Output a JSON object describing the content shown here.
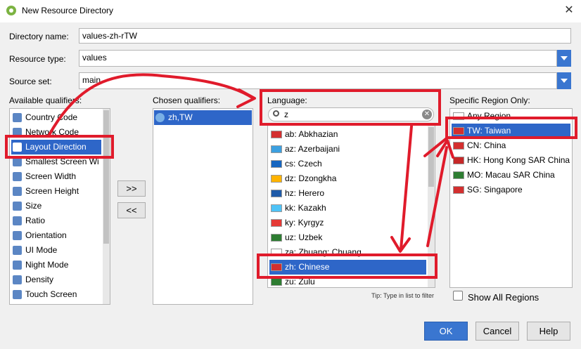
{
  "window": {
    "title": "New Resource Directory",
    "close_glyph": "✕"
  },
  "form": {
    "directory_name_label": "Directory name:",
    "directory_name_value": "values-zh-rTW",
    "resource_type_label": "Resource type:",
    "resource_type_value": "values",
    "source_set_label": "Source set:",
    "source_set_value": "main"
  },
  "available": {
    "label": "Available qualifiers:",
    "items": [
      {
        "label": "Country Code",
        "icon": "country-code-icon"
      },
      {
        "label": "Network Code",
        "icon": "network-code-icon"
      },
      {
        "label": "Layout Direction",
        "icon": "layout-direction-icon"
      },
      {
        "label": "Smallest Screen Wi",
        "icon": "smallest-screen-icon"
      },
      {
        "label": "Screen Width",
        "icon": "screen-width-icon"
      },
      {
        "label": "Screen Height",
        "icon": "screen-height-icon"
      },
      {
        "label": "Size",
        "icon": "size-icon"
      },
      {
        "label": "Ratio",
        "icon": "ratio-icon"
      },
      {
        "label": "Orientation",
        "icon": "orientation-icon"
      },
      {
        "label": "UI Mode",
        "icon": "ui-mode-icon"
      },
      {
        "label": "Night Mode",
        "icon": "night-mode-icon"
      },
      {
        "label": "Density",
        "icon": "density-icon"
      },
      {
        "label": "Touch Screen",
        "icon": "touch-screen-icon"
      }
    ]
  },
  "chosen": {
    "label": "Chosen qualifiers:",
    "items": [
      {
        "label": "zh,TW",
        "icon": "globe-icon"
      }
    ]
  },
  "buttons": {
    "add": ">>",
    "remove": "<<",
    "ok": "OK",
    "cancel": "Cancel",
    "help": "Help"
  },
  "language": {
    "label": "Language:",
    "filter_value": "z",
    "tip": "Tip: Type in list to filter",
    "items": [
      {
        "label": "ab: Abkhazian"
      },
      {
        "label": "az: Azerbaijani"
      },
      {
        "label": "cs: Czech"
      },
      {
        "label": "dz: Dzongkha"
      },
      {
        "label": "hz: Herero"
      },
      {
        "label": "kk: Kazakh"
      },
      {
        "label": "ky: Kyrgyz"
      },
      {
        "label": "uz: Uzbek"
      },
      {
        "label": "za: Zhuang; Chuang"
      },
      {
        "label": "zh: Chinese"
      },
      {
        "label": "zu: Zulu"
      }
    ]
  },
  "region": {
    "label": "Specific Region Only:",
    "items": [
      {
        "label": "Any Region"
      },
      {
        "label": "TW: Taiwan"
      },
      {
        "label": "CN: China"
      },
      {
        "label": "HK: Hong Kong SAR China"
      },
      {
        "label": "MO: Macau SAR China"
      },
      {
        "label": "SG: Singapore"
      }
    ],
    "show_all_label": "Show All Regions",
    "show_all_checked": false
  },
  "colors": {
    "selection": "#2e66c8",
    "annotation": "#e01b2b",
    "ok_button": "#3a76d0"
  }
}
